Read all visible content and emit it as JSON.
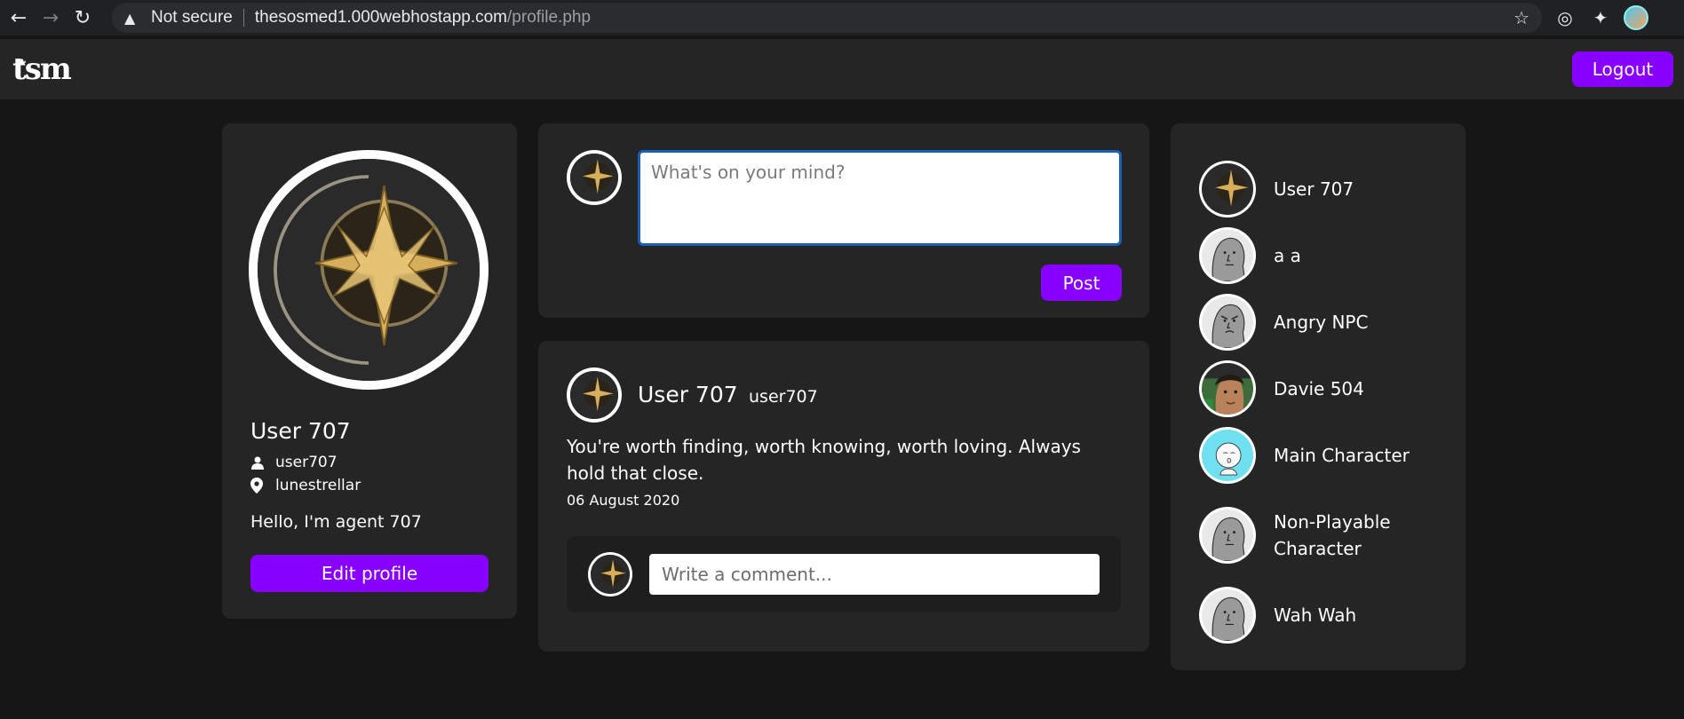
{
  "browser": {
    "security_label": "Not secure",
    "url_host": "thesosmed1.000webhostapp.com",
    "url_path": "/profile.php"
  },
  "nav": {
    "logo_text": "tsm",
    "logout_label": "Logout"
  },
  "profile": {
    "name": "User 707",
    "username": "user707",
    "location": "lunestrellar",
    "bio": "Hello, I'm agent 707",
    "edit_label": "Edit profile"
  },
  "compose": {
    "placeholder": "What's on your mind?",
    "post_label": "Post"
  },
  "post": {
    "author": "User 707",
    "handle": "user707",
    "text": "You're worth finding, worth knowing, worth loving. Always hold that close.",
    "date": "06 August 2020",
    "comment_placeholder": "Write a comment..."
  },
  "users": [
    {
      "name": "User 707",
      "avatar": "star-moon"
    },
    {
      "name": "a a",
      "avatar": "npc"
    },
    {
      "name": "Angry NPC",
      "avatar": "angry-npc"
    },
    {
      "name": "Davie 504",
      "avatar": "photo"
    },
    {
      "name": "Main Character",
      "avatar": "main-character"
    },
    {
      "name": "Non-Playable Character",
      "avatar": "npc"
    },
    {
      "name": "Wah Wah",
      "avatar": "npc"
    }
  ],
  "colors": {
    "accent": "#8800ff",
    "card": "#252525",
    "background": "#161616"
  }
}
